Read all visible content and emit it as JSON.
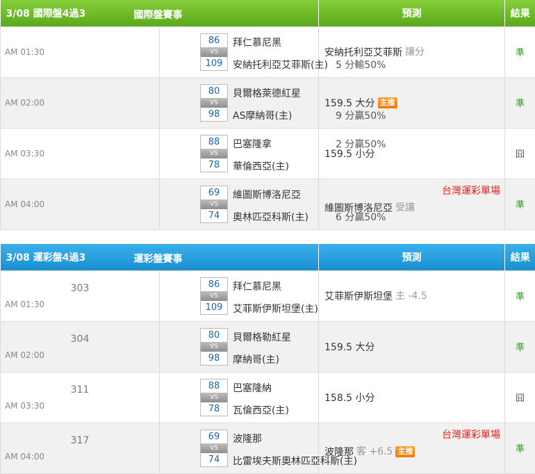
{
  "intl": {
    "header": {
      "date": "3/08 國際盤4過3",
      "title": "國際盤賽事",
      "prediction": "預測",
      "result": "結果"
    },
    "rows": [
      {
        "time": "AM 01:30",
        "home_score": "86",
        "away_score": "109",
        "vs": "VS",
        "team1": "拜仁慕尼黑",
        "team2": "安納托利亞艾菲斯(主)",
        "handicap": "5 分輸50%",
        "prediction": "安納托利亞艾菲斯",
        "pred_note": "讓分",
        "badge": "",
        "tw": "",
        "result": "準"
      },
      {
        "time": "AM 02:00",
        "home_score": "80",
        "away_score": "98",
        "vs": "VS",
        "team1": "貝爾格萊德紅星",
        "team2": "AS摩納哥(主)",
        "handicap": "9 分贏50%",
        "prediction": "159.5 大分",
        "pred_note": "",
        "badge": "主推",
        "tw": "",
        "result": "準"
      },
      {
        "time": "AM 03:30",
        "home_score": "88",
        "away_score": "78",
        "vs": "VS",
        "team1": "巴塞隆拿",
        "team2": "華倫西亞(主)",
        "handicap": "2 分贏50%",
        "prediction": "159.5 小分",
        "pred_note": "",
        "badge": "",
        "tw": "",
        "result": "囧"
      },
      {
        "time": "AM 04:00",
        "home_score": "69",
        "away_score": "74",
        "vs": "VS",
        "team1": "維圖斯博洛尼亞",
        "team2": "奧林匹亞科斯(主)",
        "handicap": "6 分贏50%",
        "prediction": "維圖斯博洛尼亞",
        "pred_note": "受讓",
        "badge": "",
        "tw": "台灣運彩單場",
        "result": "準"
      }
    ]
  },
  "sport": {
    "header": {
      "date": "3/08 運彩盤4過3",
      "title": "運彩盤賽事",
      "prediction": "預測",
      "result": "結果"
    },
    "rows": [
      {
        "num": "303",
        "time": "AM 01:30",
        "home_score": "86",
        "away_score": "109",
        "vs": "VS",
        "team1": "拜仁慕尼黑",
        "team2": "艾菲斯伊斯坦堡(主)",
        "prediction": "艾菲斯伊斯坦堡",
        "pred_note": "主 -4.5",
        "badge": "",
        "tw": "",
        "result": "準"
      },
      {
        "num": "304",
        "time": "AM 02:00",
        "home_score": "80",
        "away_score": "98",
        "vs": "VS",
        "team1": "貝爾格勒紅星",
        "team2": "摩納哥(主)",
        "prediction": "159.5 大分",
        "pred_note": "",
        "badge": "",
        "tw": "",
        "result": "準"
      },
      {
        "num": "311",
        "time": "AM 03:30",
        "home_score": "88",
        "away_score": "78",
        "vs": "VS",
        "team1": "巴塞隆納",
        "team2": "瓦倫西亞(主)",
        "prediction": "158.5 小分",
        "pred_note": "",
        "badge": "",
        "tw": "",
        "result": "囧"
      },
      {
        "num": "317",
        "time": "AM 04:00",
        "home_score": "69",
        "away_score": "74",
        "vs": "VS",
        "team1": "波隆那",
        "team2": "比雷埃夫斯奧林匹亞科斯(主)",
        "prediction": "波隆那",
        "pred_note": "客 +6.5",
        "badge": "主推",
        "tw": "台灣運彩單場",
        "result": "準"
      }
    ]
  },
  "colors": {
    "intl_header": "#6cbd2a",
    "sport_header": "#2aa2e0",
    "result_ok": "#2a9a1a",
    "tw_label": "#e02020",
    "badge": "#f08a10",
    "score": "#1a63ad"
  }
}
